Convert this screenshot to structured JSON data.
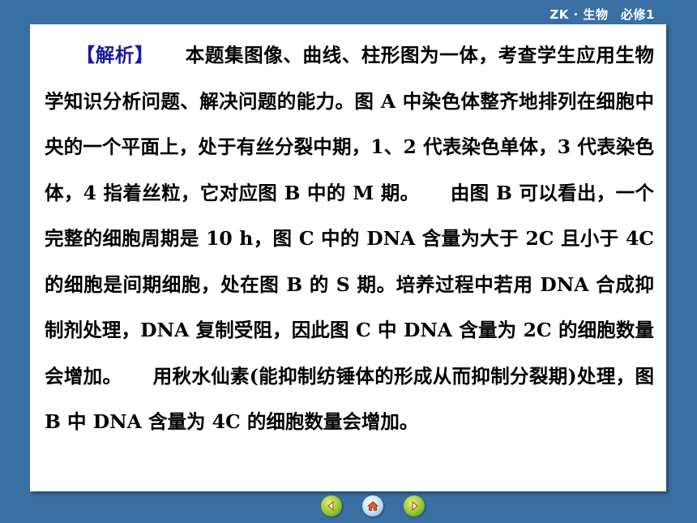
{
  "header": {
    "title": "ZK · 生物　必修1"
  },
  "content": {
    "tag": "【解析】",
    "paragraph1": "本题集图像、曲线、柱形图为一体，考查学生应用生物学知识分析问题、解决问题的能力。图 A 中染色体整齐地排列在细胞中央的一个平面上，处于有丝分裂中期，1、2 代表染色单体，3 代表染色体，4 指着丝粒，它对应图 B 中的 M 期。",
    "paragraph2": "由图 B 可以看出，一个完整的细胞周期是 10 h，图 C 中的 DNA 含量为大于 2C 且小于 4C 的细胞是间期细胞，处在图 B 的 S 期。培养过程中若用 DNA 合成抑制剂处理，DNA 复制受阻，因此图 C 中 DNA 含量为 2C 的细胞数量会增加。",
    "paragraph3": "用秋水仙素(能抑制纺锤体的形成从而抑制分裂期)处理，图 B 中 DNA 含量为 4C 的细胞数量会增加。"
  },
  "nav": {
    "prev_icon": "back-arrow-icon",
    "home_icon": "home-icon",
    "next_icon": "forward-arrow-icon"
  },
  "colors": {
    "background": "#3a6fa3",
    "panel": "#ffffff",
    "tag": "#1a1aa0"
  }
}
